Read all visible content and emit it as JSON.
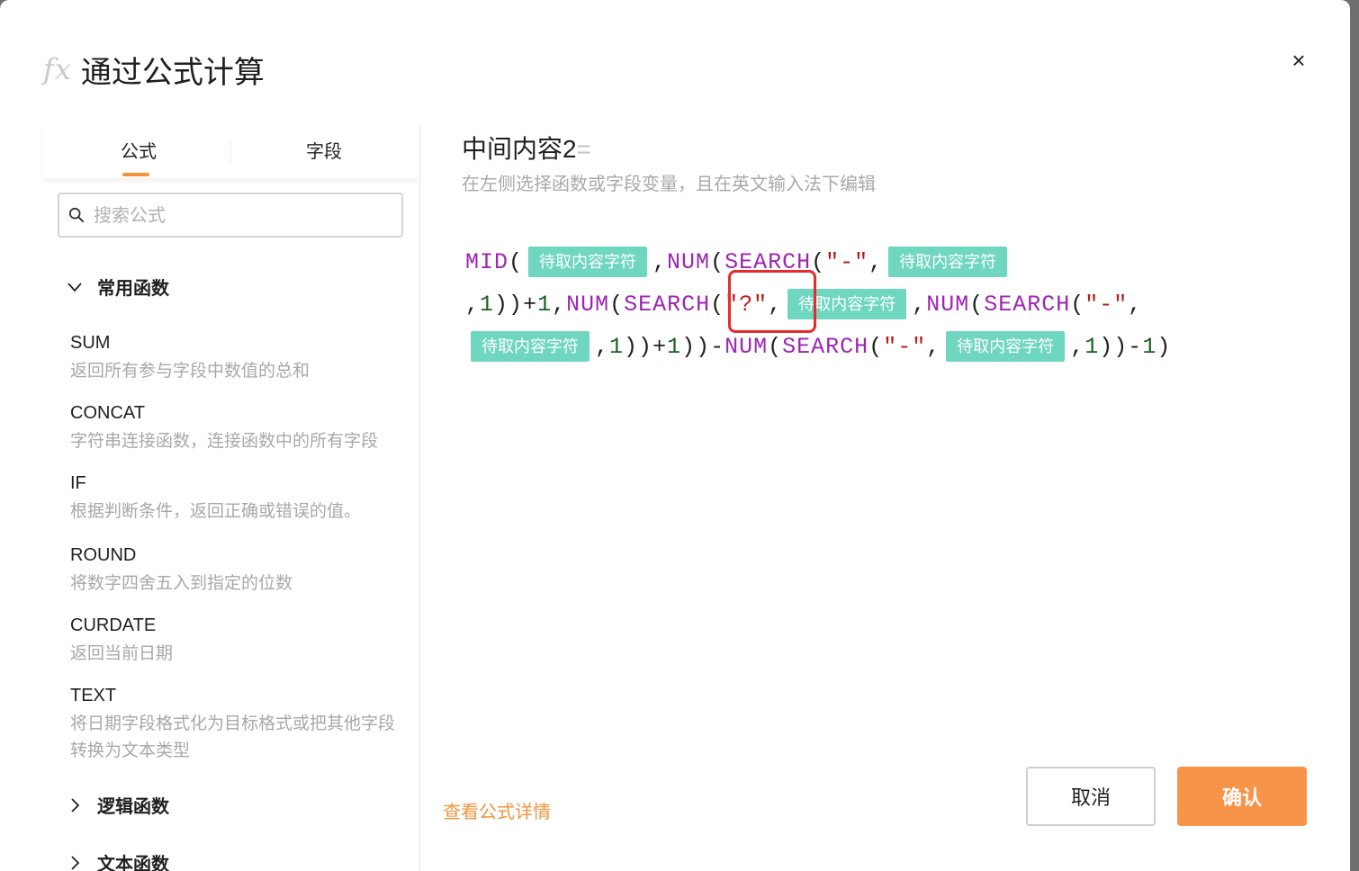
{
  "header": {
    "icon": "fx-icon",
    "fx_text": "fx",
    "title": "通过公式计算",
    "close_label": "×"
  },
  "sidebar": {
    "tabs": [
      {
        "label": "公式",
        "active": true
      },
      {
        "label": "字段",
        "active": false
      }
    ],
    "search_placeholder": "搜索公式",
    "groups": [
      {
        "label": "常用函数",
        "expanded": true
      },
      {
        "label": "逻辑函数",
        "expanded": false
      },
      {
        "label": "文本函数",
        "expanded": false
      }
    ],
    "functions": [
      {
        "name": "SUM",
        "desc": "返回所有参与字段中数值的总和"
      },
      {
        "name": "CONCAT",
        "desc": "字符串连接函数，连接函数中的所有字段"
      },
      {
        "name": "IF",
        "desc": "根据判断条件，返回正确或错误的值。"
      },
      {
        "name": "ROUND",
        "desc": "将数字四舍五入到指定的位数"
      },
      {
        "name": "CURDATE",
        "desc": "返回当前日期"
      },
      {
        "name": "TEXT",
        "desc": "将日期字段格式化为目标格式或把其他字段转换为文本类型"
      }
    ]
  },
  "editor": {
    "var_name": "中间内容2",
    "eq": "=",
    "hint": "在左侧选择函数或字段变量，且在英文输入法下编辑",
    "chip_label": "待取内容字符",
    "tokens": {
      "mid": "MID",
      "num": "NUM",
      "search": "SEARCH",
      "lp": "(",
      "rp": ")",
      "comma": ",",
      "plus": "+",
      "minus": "-",
      "one": "1",
      "dash_str": "\"-\"",
      "q_str": "\"?\""
    }
  },
  "footer": {
    "details_link": "查看公式详情",
    "cancel_label": "取消",
    "confirm_label": "确认"
  },
  "colors": {
    "accent": "#f4933a",
    "confirm_bg": "#f7944a",
    "chip_bg": "#6fd6c0",
    "keyword": "#9c27b0",
    "string": "#b71c1c",
    "number": "#1b5e20",
    "highlight": "#e52b2b"
  }
}
